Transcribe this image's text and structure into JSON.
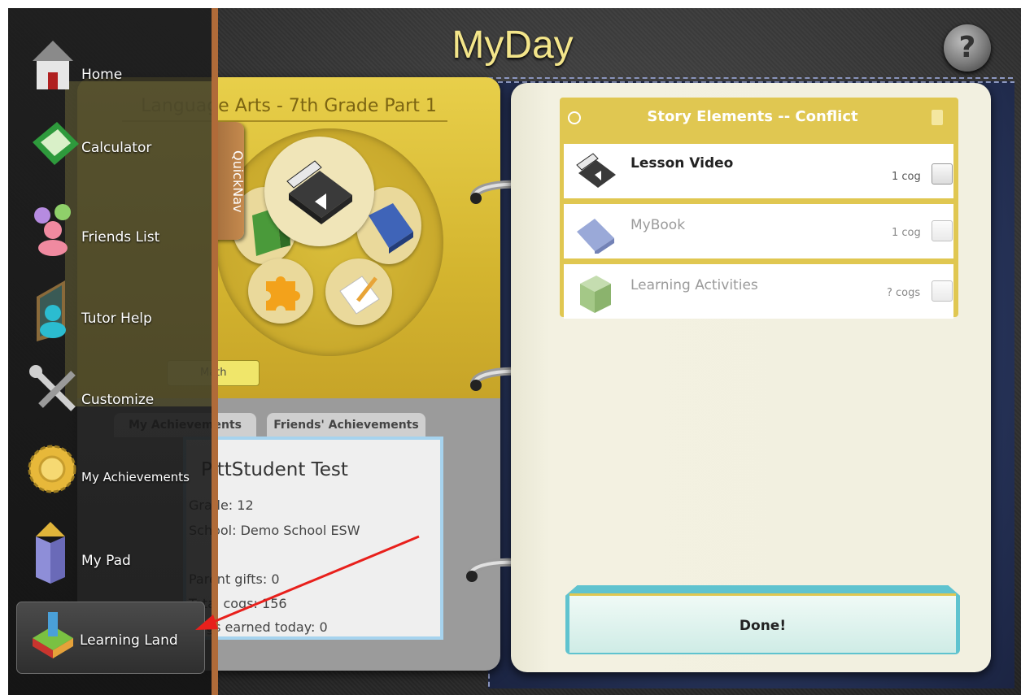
{
  "app": {
    "title": "MyDay",
    "help_icon": "?"
  },
  "course": {
    "title": "Language Arts - 7th Grade Part 1",
    "quicknav_label": "QuickNav",
    "math_tab": "Math"
  },
  "achievements_tabs": {
    "mine": "My Achievements",
    "friends": "Friends' Achievements"
  },
  "profile": {
    "name": "PittStudent Test",
    "grade_label": "Grade:",
    "grade": "12",
    "school_label": "School:",
    "school": "Demo School ESW",
    "parent_gifts_label": "Parent gifts:",
    "parent_gifts": "0",
    "total_cogs_label": "Total cogs:",
    "total_cogs": "156",
    "cogs_today_label": "Cogs earned today:",
    "cogs_today": "0"
  },
  "task_list": {
    "title": "Story Elements -- Conflict",
    "items": [
      {
        "label": "Lesson Video",
        "cost": "1 cog",
        "icon": "clapperboard-icon",
        "enabled": true
      },
      {
        "label": "MyBook",
        "cost": "1 cog",
        "icon": "book-icon",
        "enabled": false
      },
      {
        "label": "Learning Activities",
        "cost": "? cogs",
        "icon": "question-cube-icon",
        "enabled": false
      }
    ],
    "done_label": "Done!"
  },
  "side_menu": {
    "items": [
      {
        "label": "Home",
        "icon": "house-icon"
      },
      {
        "label": "Calculator",
        "icon": "calculator-icon"
      },
      {
        "label": "Friends List",
        "icon": "friends-icon"
      },
      {
        "label": "Tutor Help",
        "icon": "tutor-icon"
      },
      {
        "label": "Customize",
        "icon": "wrench-icon"
      },
      {
        "label": "My Achievements",
        "icon": "gear-medal-icon"
      },
      {
        "label": "My Pad",
        "icon": "tower-icon"
      },
      {
        "label": "Learning Land",
        "icon": "learning-land-icon"
      }
    ],
    "selected": "Learning Land"
  },
  "colors": {
    "accent_gold": "#e0c751",
    "menu_border": "#b06b39",
    "annotation_arrow": "#e8201c"
  }
}
